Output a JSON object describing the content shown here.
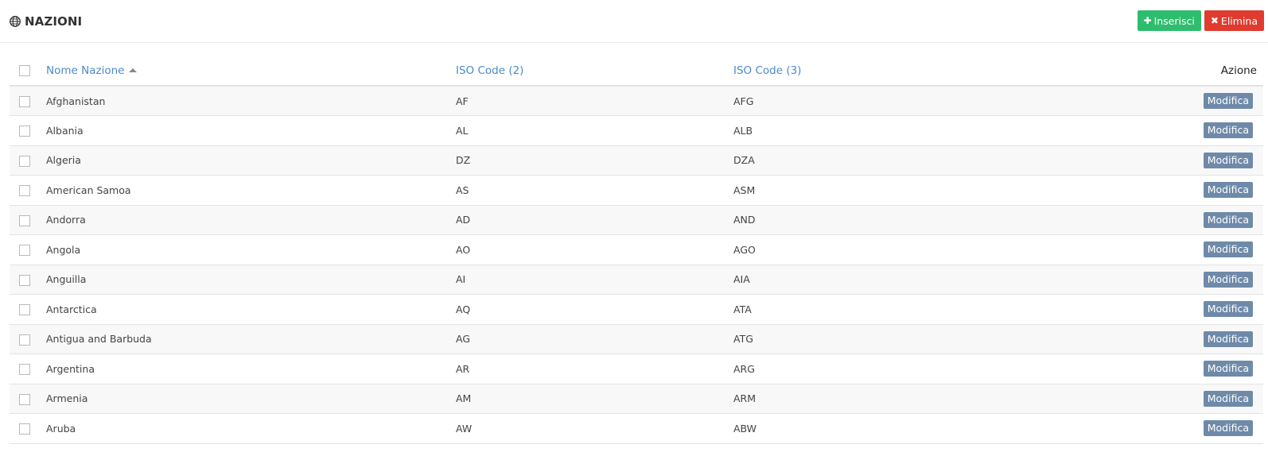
{
  "header": {
    "title": "NAZIONI",
    "insert_label": "Inserisci",
    "delete_label": "Elimina",
    "insert_icon": "plus-icon",
    "delete_icon": "times-icon",
    "title_icon": "globe-icon"
  },
  "table": {
    "columns": {
      "name": "Nome Nazione",
      "iso2": "ISO Code (2)",
      "iso3": "ISO Code (3)",
      "action": "Azione"
    },
    "edit_label": "Modifica",
    "rows": [
      {
        "name": "Afghanistan",
        "iso2": "AF",
        "iso3": "AFG"
      },
      {
        "name": "Albania",
        "iso2": "AL",
        "iso3": "ALB"
      },
      {
        "name": "Algeria",
        "iso2": "DZ",
        "iso3": "DZA"
      },
      {
        "name": "American Samoa",
        "iso2": "AS",
        "iso3": "ASM"
      },
      {
        "name": "Andorra",
        "iso2": "AD",
        "iso3": "AND"
      },
      {
        "name": "Angola",
        "iso2": "AO",
        "iso3": "AGO"
      },
      {
        "name": "Anguilla",
        "iso2": "AI",
        "iso3": "AIA"
      },
      {
        "name": "Antarctica",
        "iso2": "AQ",
        "iso3": "ATA"
      },
      {
        "name": "Antigua and Barbuda",
        "iso2": "AG",
        "iso3": "ATG"
      },
      {
        "name": "Argentina",
        "iso2": "AR",
        "iso3": "ARG"
      },
      {
        "name": "Armenia",
        "iso2": "AM",
        "iso3": "ARM"
      },
      {
        "name": "Aruba",
        "iso2": "AW",
        "iso3": "ABW"
      }
    ]
  },
  "colors": {
    "insert": "#2ebd6e",
    "delete": "#df3b2f",
    "edit": "#6f8aa9",
    "link": "#4b8ac9"
  }
}
